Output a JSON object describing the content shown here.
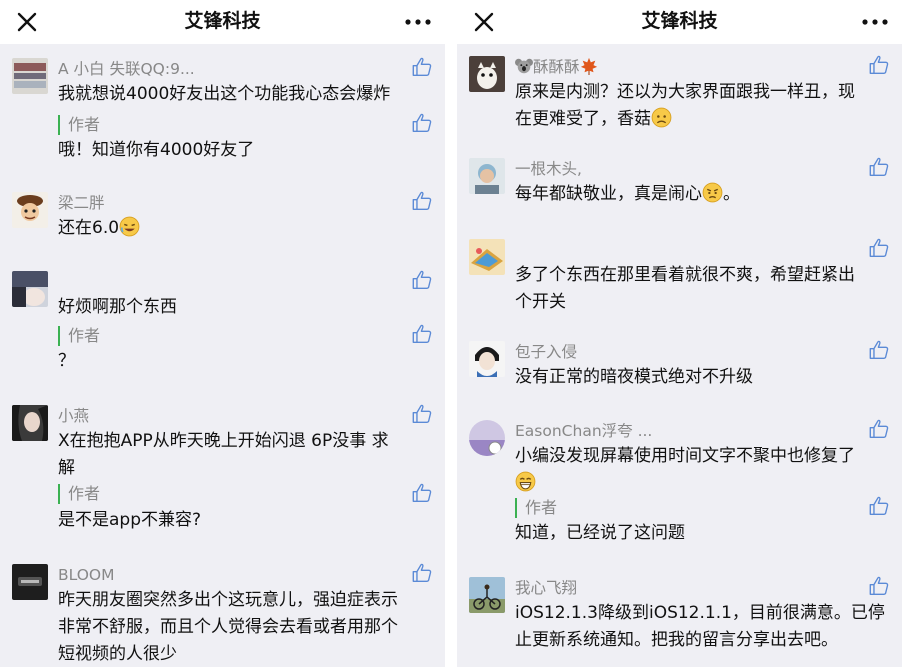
{
  "nav": {
    "title": "艾锋科技"
  },
  "left": {
    "comments": [
      {
        "nick": "A 小白 失联QQ:9...",
        "text": "我就想说4000好友出这个功能我心态会爆炸",
        "author_label": "作者",
        "reply": "哦！知道你有4000好友了"
      },
      {
        "nick": "梁二胖",
        "text": "还在6.0"
      },
      {
        "nick": "",
        "text": "好烦啊那个东西",
        "author_label": "作者",
        "reply": "？"
      },
      {
        "nick": "小燕",
        "text_l1": "X在抱抱APP从昨天晚上开始闪退 6P没事 求",
        "text_l2": "解",
        "author_label": "作者",
        "reply": "是不是app不兼容?"
      },
      {
        "nick": "BLOOM",
        "text_l1": "昨天朋友圈突然多出个这玩意儿，强迫症表示",
        "text_l2": "非常不舒服，而且个人觉得会去看或者用那个",
        "text_l3": "短视频的人很少"
      }
    ]
  },
  "right": {
    "comments": [
      {
        "nick": "酥酥酥",
        "text_l1": "原来是内测？还以为大家界面跟我一样丑，现",
        "text_l2": "在更难受了，香菇"
      },
      {
        "nick": "一根木头,",
        "text": "每年都缺敬业，真是闹心",
        "text_tail": "。"
      },
      {
        "nick": "",
        "text_l1": "多了个东西在那里看着就很不爽，希望赶紧出",
        "text_l2": "个开关"
      },
      {
        "nick": "包子入侵",
        "text": "没有正常的暗夜模式绝对不升级"
      },
      {
        "nick": "EasonChan浮夸 ...",
        "text": "小编没发现屏幕使用时间文字不聚中也修复了",
        "author_label": "作者",
        "reply": "知道，已经说了这问题"
      },
      {
        "nick": "我心飞翔",
        "text_l1": "iOS12.1.3降级到iOS12.1.1，目前很满意。已停",
        "text_l2": "止更新系统通知。把我的留言分享出去吧。"
      }
    ]
  },
  "colors": {
    "author_bar": "#3bb152",
    "nick": "#888888",
    "background": "#efeff4"
  }
}
